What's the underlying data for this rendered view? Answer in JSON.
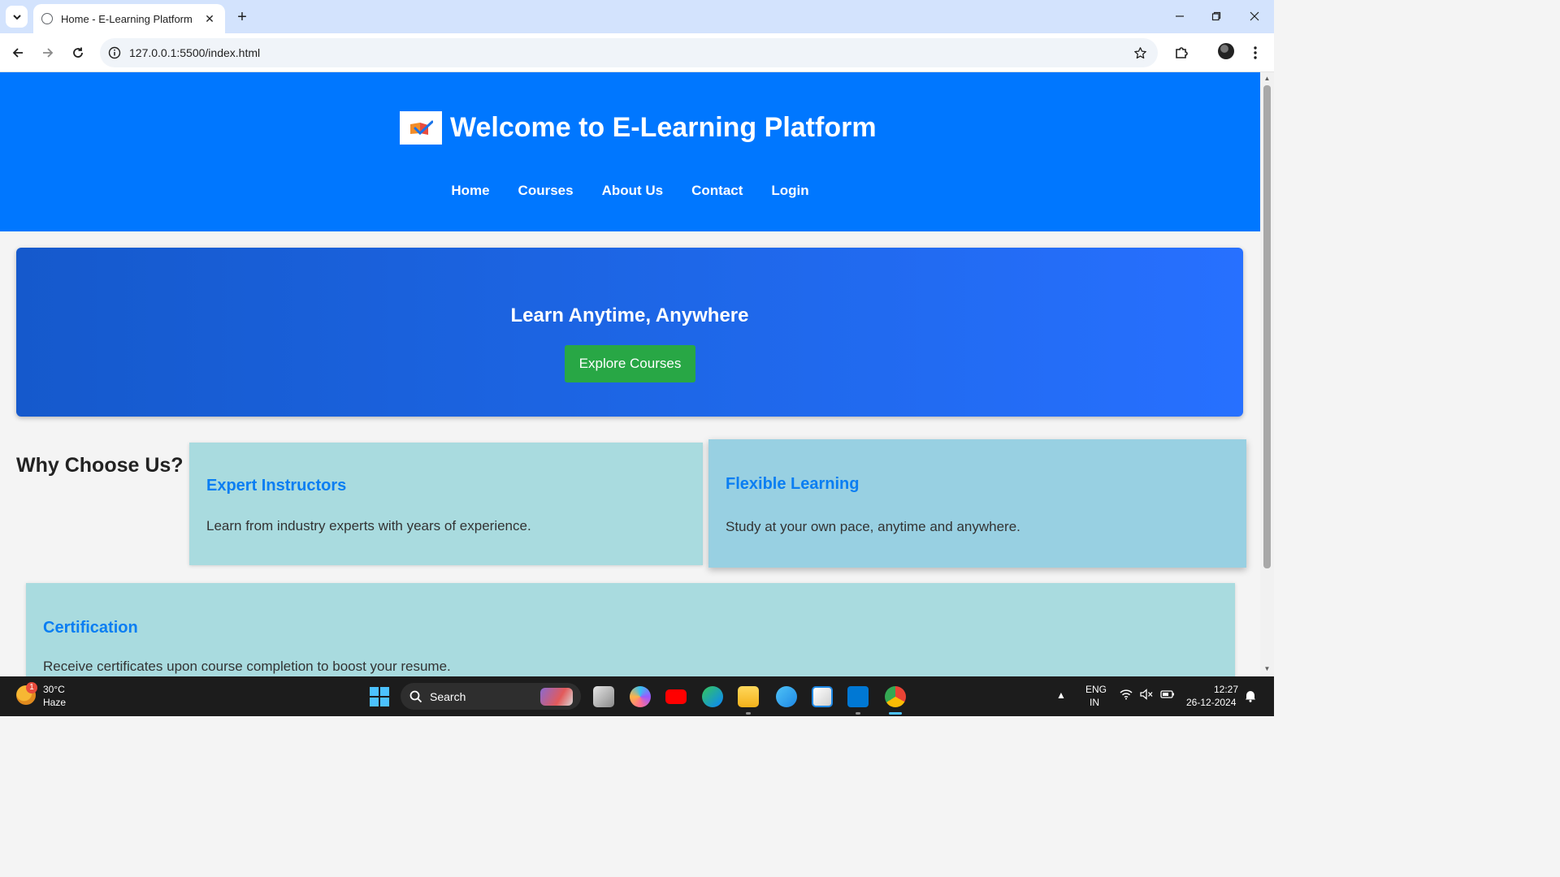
{
  "browser": {
    "tab_title": "Home - E-Learning Platform",
    "url": "127.0.0.1:5500/index.html"
  },
  "site": {
    "title": "Welcome to E-Learning Platform",
    "nav": [
      "Home",
      "Courses",
      "About Us",
      "Contact",
      "Login"
    ],
    "hero": {
      "title": "Learn Anytime, Anywhere",
      "button": "Explore Courses"
    },
    "why_title": "Why Choose Us?",
    "features": [
      {
        "title": "Expert Instructors",
        "text": "Learn from industry experts with years of experience."
      },
      {
        "title": "Flexible Learning",
        "text": "Study at your own pace, anytime and anywhere."
      },
      {
        "title": "Certification",
        "text": "Receive certificates upon course completion to boost your resume."
      }
    ],
    "colors": {
      "header": "#0077ff",
      "button": "#28a745",
      "card_title": "#0a7ef2"
    }
  },
  "taskbar": {
    "weather_temp": "30°C",
    "weather_desc": "Haze",
    "weather_badge": "1",
    "search_label": "Search",
    "lang_line1": "ENG",
    "lang_line2": "IN",
    "time": "12:27",
    "date": "26-12-2024"
  }
}
